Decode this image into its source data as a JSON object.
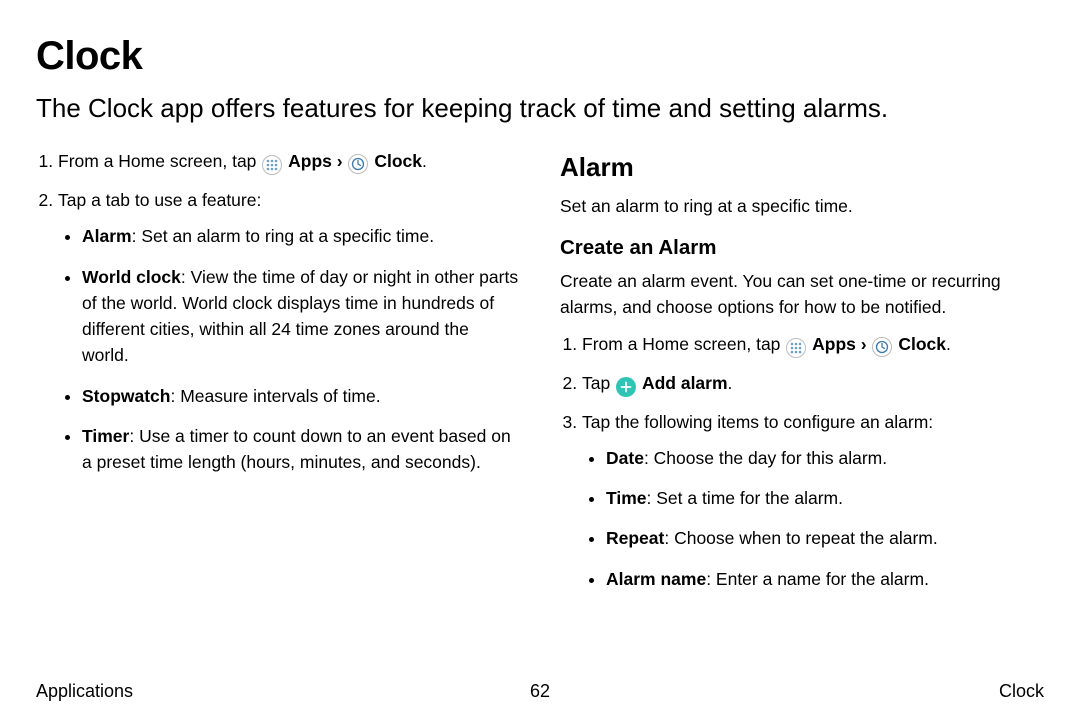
{
  "title": "Clock",
  "subtitle": "The Clock app offers features for keeping track of time and setting alarms.",
  "left": {
    "step1_pre": "From a Home screen, tap ",
    "apps_label": "Apps",
    "clock_label": "Clock",
    "step2": "Tap a tab to use a feature:",
    "features": {
      "alarm_b": "Alarm",
      "alarm_t": ": Set an alarm to ring at a specific time.",
      "world_b": "World clock",
      "world_t": ": View the time of day or night in other parts of the world. World clock displays time in hundreds of different cities, within all 24 time zones around the world.",
      "stop_b": "Stopwatch",
      "stop_t": ": Measure intervals of time.",
      "timer_b": "Timer",
      "timer_t": ": Use a timer to count down to an event based on a preset time length (hours, minutes, and seconds)."
    }
  },
  "right": {
    "h2": "Alarm",
    "intro": "Set an alarm to ring at a specific time.",
    "h3": "Create an Alarm",
    "create_intro": "Create an alarm event. You can set one-time or recurring alarms, and choose options for how to be notified.",
    "step1_pre": "From a Home screen, tap ",
    "apps_label": "Apps",
    "clock_label": "Clock",
    "step2_pre": "Tap ",
    "add_alarm_label": "Add alarm",
    "step3": "Tap the following items to configure an alarm:",
    "config": {
      "date_b": "Date",
      "date_t": ": Choose the day for this alarm.",
      "time_b": "Time",
      "time_t": ": Set a time for the alarm.",
      "repeat_b": "Repeat",
      "repeat_t": ": Choose when to repeat the alarm.",
      "name_b": "Alarm name",
      "name_t": ": Enter a name for the alarm."
    }
  },
  "footer": {
    "left": "Applications",
    "center": "62",
    "right": "Clock"
  },
  "period": "."
}
